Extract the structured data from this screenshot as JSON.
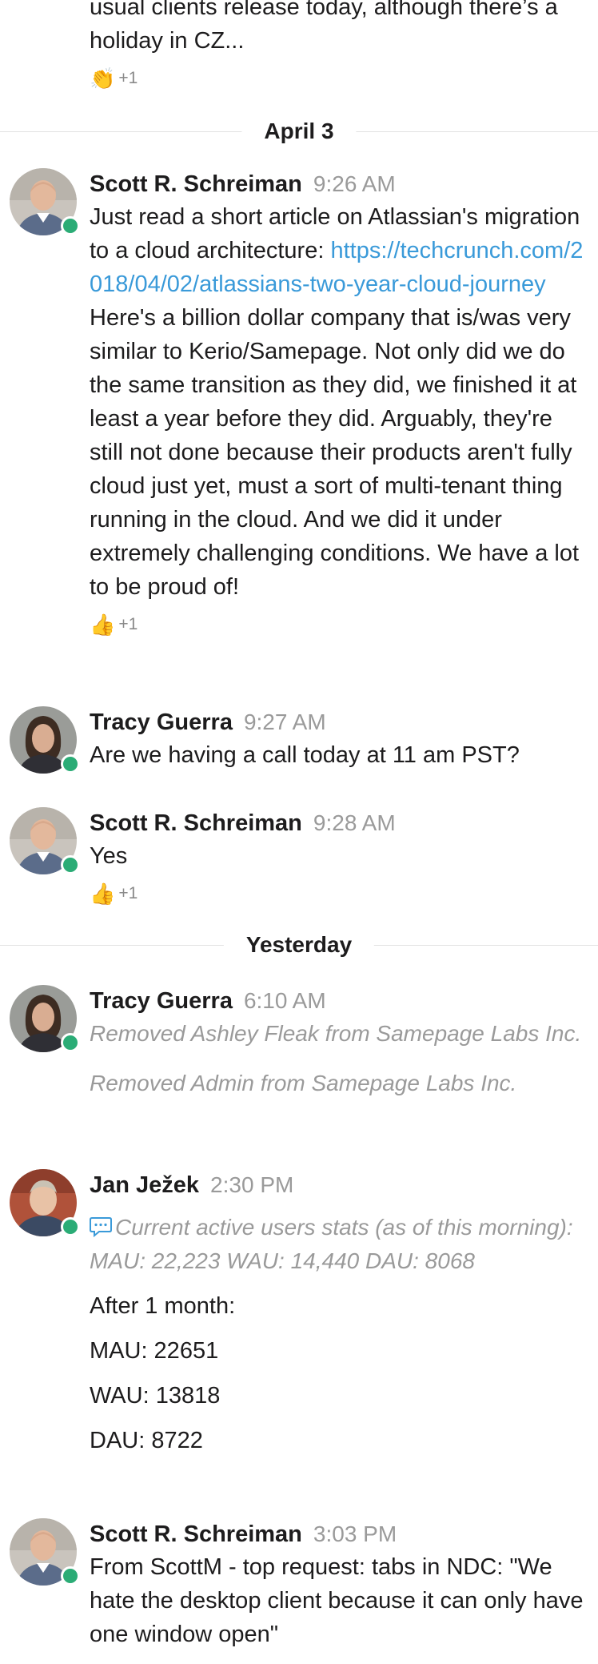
{
  "top_fragment": {
    "lines": [
      "usual clients release today, although there’s a",
      "holiday in CZ..."
    ],
    "reaction": {
      "emoji": "👏",
      "count": "+1"
    }
  },
  "dividers": {
    "april3": "April 3",
    "yesterday": "Yesterday"
  },
  "messages": [
    {
      "author": "Scott R. Schreiman",
      "time": "9:26 AM",
      "text_before": "Just read a short article on Atlassian's migration to a cloud architecture: ",
      "link": "https://techcrunch.com/2018/04/02/atlassians-two-year-cloud-journey",
      "text_after": " Here's a billion dollar company that is/was very similar to Kerio/Samepage. Not only did we do the same transition as they did, we finished it at least a year before they did. Arguably, they're still not done because their products aren't fully cloud just yet, must a sort of multi-tenant thing running in the cloud. And we did it under extremely challenging conditions. We have a lot to be proud of!",
      "reaction": {
        "emoji": "👍",
        "count": "+1"
      }
    },
    {
      "author": "Tracy Guerra",
      "time": "9:27 AM",
      "text": "Are we having a call today at 11 am PST?"
    },
    {
      "author": "Scott R. Schreiman",
      "time": "9:28 AM",
      "text": "Yes",
      "reaction": {
        "emoji": "👍",
        "count": "+1"
      }
    },
    {
      "author": "Tracy Guerra",
      "time": "6:10 AM",
      "system_lines": [
        "Removed Ashley Fleak from Samepage Labs Inc.",
        "Removed Admin from Samepage Labs Inc."
      ]
    },
    {
      "author": "Jan Ježek",
      "time": "2:30 PM",
      "quote": "Current active users stats (as of this morning): MAU: 22,223 WAU: 14,440 DAU: 8068",
      "lines": [
        "After 1 month:",
        "MAU: 22651",
        "WAU: 13818",
        "DAU: 8722"
      ]
    },
    {
      "author": "Scott R. Schreiman",
      "time": "3:03 PM",
      "text": "From ScottM - top request: tabs in NDC: \"We hate the desktop client because it can only have one window open\""
    }
  ],
  "colors": {
    "link": "#3a9ad9",
    "presence": "#2bac76",
    "timestamp": "#9a9a9a"
  }
}
